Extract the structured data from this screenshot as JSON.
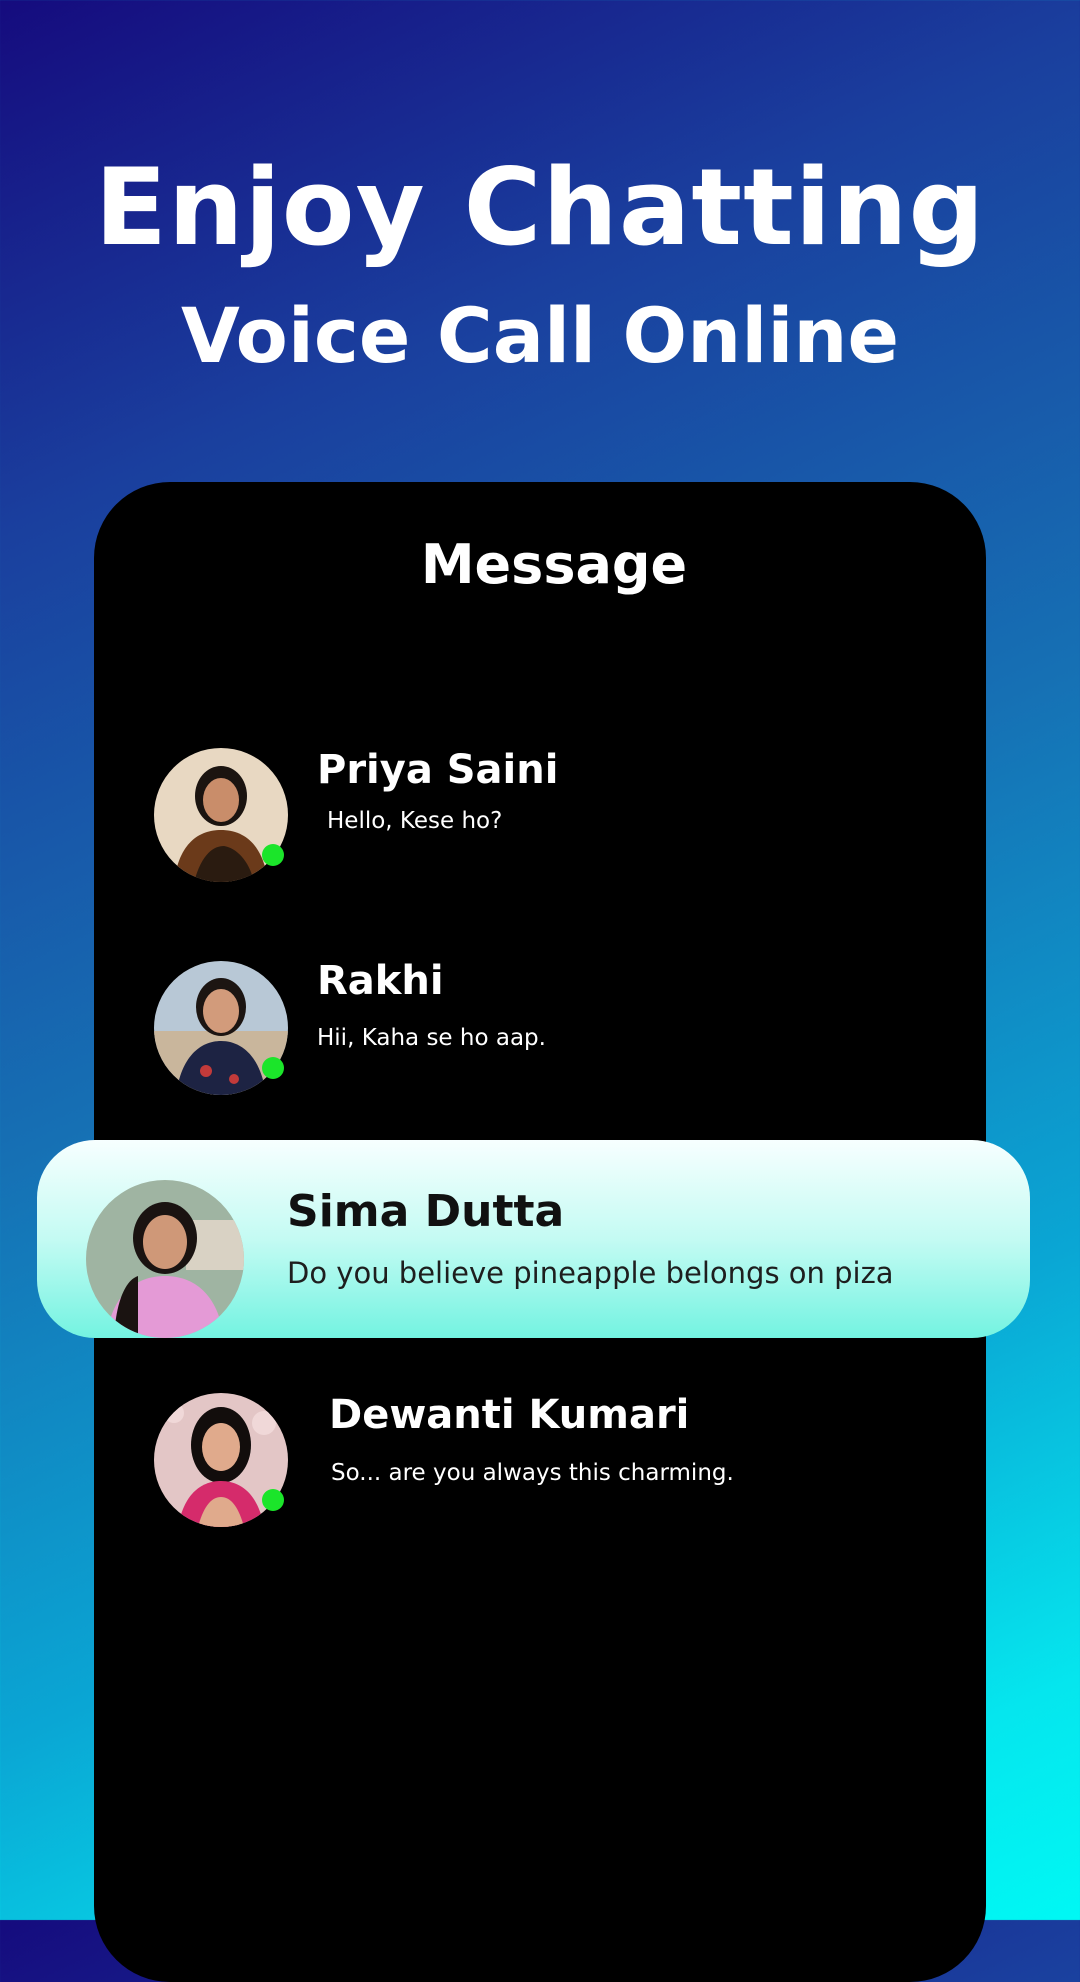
{
  "headline": {
    "main": "Enjoy Chatting",
    "sub": "Voice Call Online"
  },
  "screen": {
    "title": "Message"
  },
  "chats": [
    {
      "name": "Priya Saini",
      "message": "Hello, Kese ho?",
      "online": true,
      "avatar_palette": {
        "bg": "#e8d8c2",
        "hair": "#1b1410",
        "skin": "#c98d6a",
        "clothes": "#6b3a1a"
      }
    },
    {
      "name": "Rakhi",
      "message": "Hii, Kaha se ho aap.",
      "online": true,
      "avatar_palette": {
        "bg": "#b8c8d6",
        "hair": "#1c1512",
        "skin": "#d29b7b",
        "clothes": "#1d2343"
      }
    },
    {
      "name": "Sima Dutta",
      "message": "Do you believe pineapple belongs on piza",
      "online": false,
      "highlighted": true,
      "avatar_palette": {
        "bg": "#9fb4a2",
        "hair": "#1a1311",
        "skin": "#cf9878",
        "clothes": "#e49ad6"
      }
    },
    {
      "name": "Dewanti Kumari",
      "message": "So... are you always this charming.",
      "online": true,
      "avatar_palette": {
        "bg": "#e3c6c6",
        "hair": "#120d0c",
        "skin": "#e0aa8c",
        "clothes": "#d52b6b"
      }
    }
  ],
  "colors": {
    "online_indicator": "#1be52a",
    "phone_background": "#000000",
    "highlight_card_top": "#f7ffff",
    "highlight_card_bottom": "#73f3e1"
  }
}
